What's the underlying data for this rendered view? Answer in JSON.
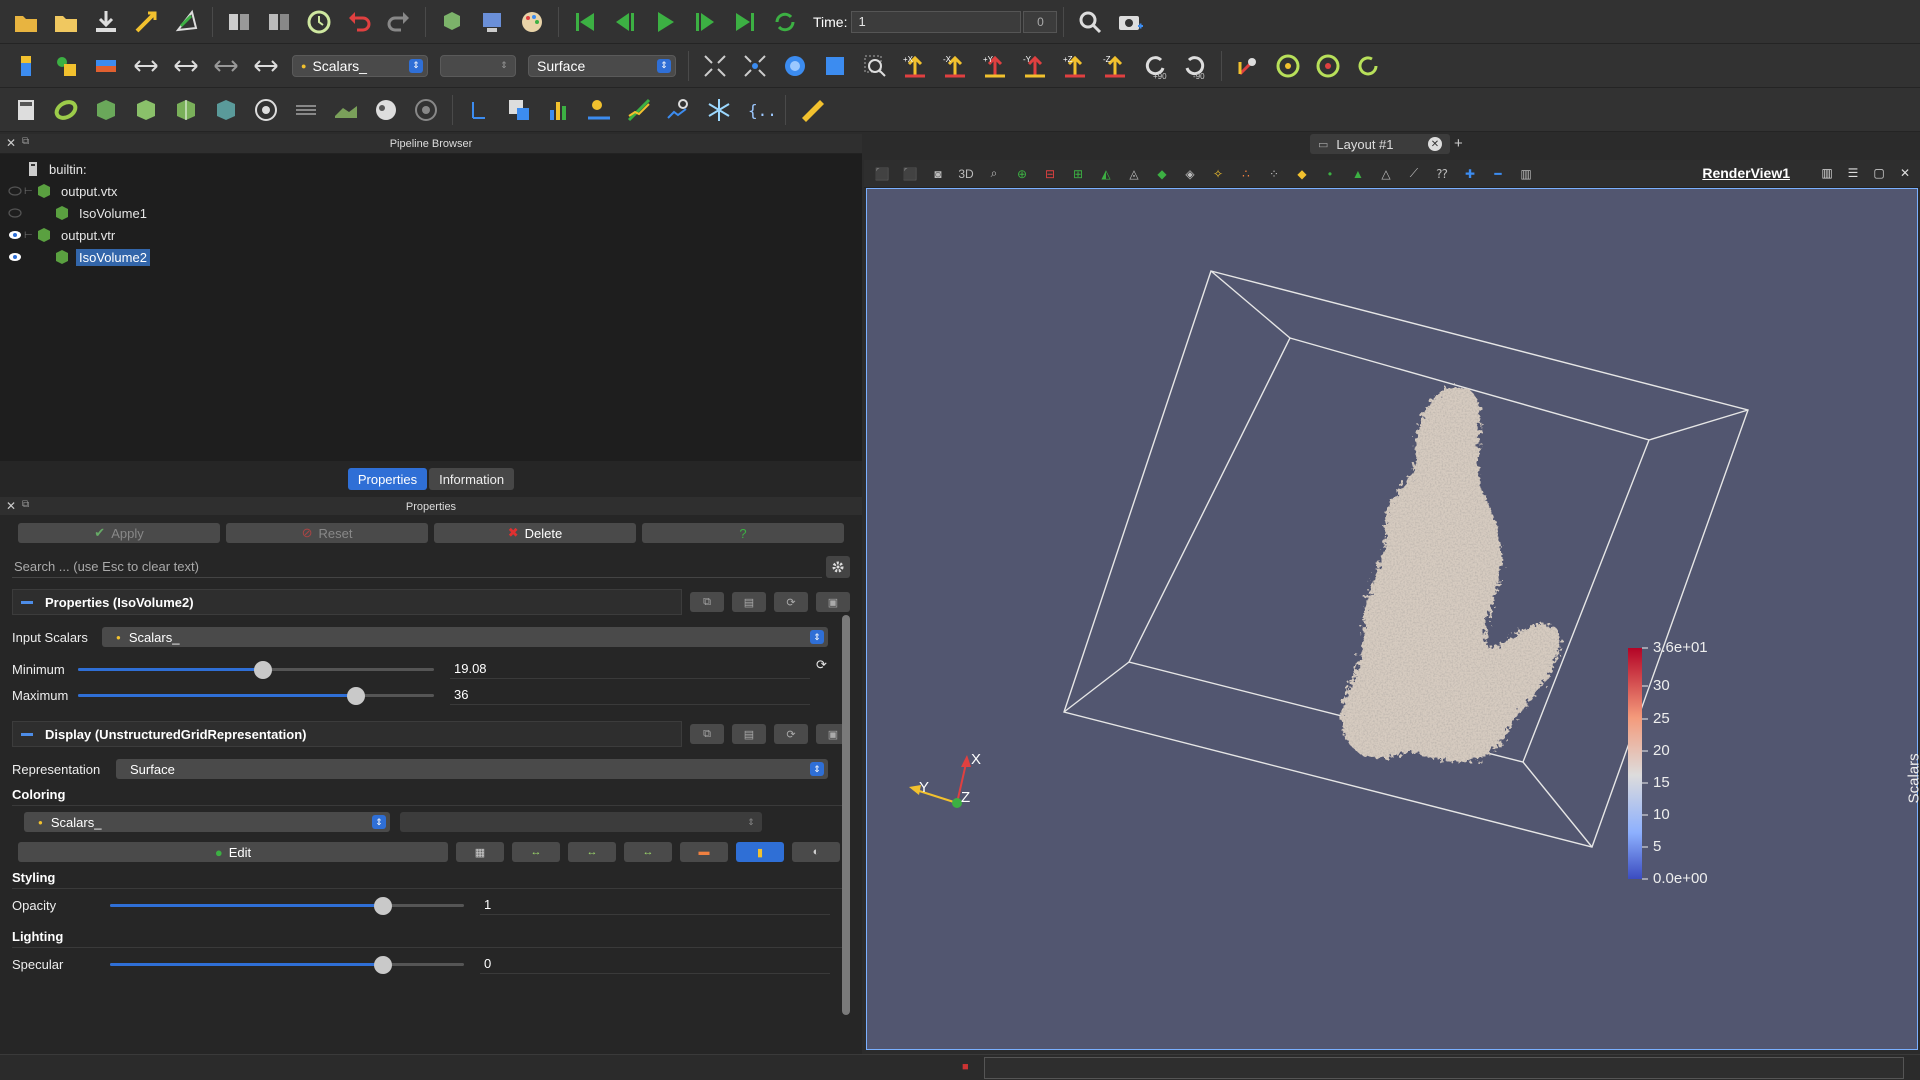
{
  "toolbar": {
    "time_label": "Time:",
    "time_value": "1",
    "time_spin": "0",
    "scalars_combo": "Scalars_",
    "empty_combo": "",
    "representation_combo": "Surface",
    "rotate_plus": "+90",
    "rotate_minus": "-90",
    "view_buttons": [
      "+X",
      "-X",
      "+Y",
      "-Y",
      "+Z",
      "-Z"
    ]
  },
  "pipeline": {
    "title": "Pipeline Browser",
    "root": "builtin:",
    "items": [
      {
        "label": "output.vtx",
        "visible": false
      },
      {
        "label": "IsoVolume1",
        "visible": false
      },
      {
        "label": "output.vtr",
        "visible": true
      },
      {
        "label": "IsoVolume2",
        "visible": true,
        "selected": true
      }
    ]
  },
  "tabs": {
    "properties": "Properties",
    "information": "Information"
  },
  "properties": {
    "title": "Properties",
    "apply": "Apply",
    "reset": "Reset",
    "delete": "Delete",
    "help": "?",
    "search_placeholder": "Search ... (use Esc to clear text)",
    "section1": "Properties (IsoVolume2)",
    "input_scalars_label": "Input Scalars",
    "input_scalars_value": "Scalars_",
    "minimum_label": "Minimum",
    "minimum_value": "19.08",
    "minimum_fraction": 0.52,
    "maximum_label": "Maximum",
    "maximum_value": "36",
    "maximum_fraction": 0.78,
    "section2": "Display (UnstructuredGridRepresentation)",
    "representation_label": "Representation",
    "representation_value": "Surface",
    "coloring_label": "Coloring",
    "coloring_value": "Scalars_",
    "edit_label": "Edit",
    "styling_label": "Styling",
    "opacity_label": "Opacity",
    "opacity_value": "1",
    "opacity_fraction": 0.77,
    "lighting_label": "Lighting",
    "specular_label": "Specular",
    "specular_value": "0",
    "specular_fraction": 0.77
  },
  "layout": {
    "tab_label": "Layout #1",
    "plus": "+",
    "render_view": "RenderView1",
    "view_3d": "3D"
  },
  "colorbar": {
    "title": "Scalars_",
    "max_label": "3.6e+01",
    "min_label": "0.0e+00",
    "ticks": [
      "30",
      "25",
      "20",
      "15",
      "10",
      "5"
    ],
    "colors": [
      "#b40426",
      "#f49a7b",
      "#dddcdc",
      "#8db0fe",
      "#3b4cc0"
    ]
  },
  "axes": {
    "x": "X",
    "y": "Y",
    "z": "Z"
  },
  "colors": {
    "accent": "#2f6fd6",
    "render_bg": "#525670",
    "surface": "#d6cbc0"
  }
}
